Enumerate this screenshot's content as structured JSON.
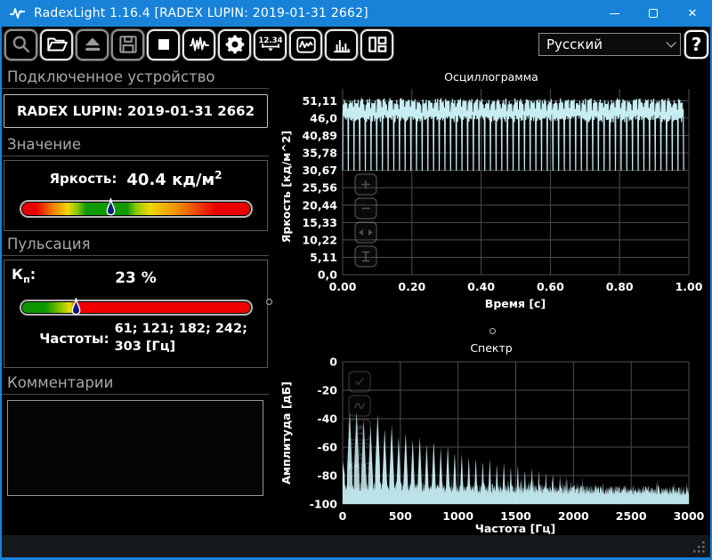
{
  "window": {
    "title": "RadexLight 1.16.4 [RADEX LUPIN: 2019-01-31 2662]"
  },
  "toolbar": {
    "buttons": [
      {
        "name": "zoom",
        "enabled": false
      },
      {
        "name": "open",
        "enabled": true
      },
      {
        "name": "eject",
        "enabled": false
      },
      {
        "name": "save",
        "enabled": false
      },
      {
        "name": "stop",
        "enabled": true
      },
      {
        "name": "oscillogram",
        "enabled": true
      },
      {
        "name": "settings",
        "enabled": true
      },
      {
        "name": "numeric-display",
        "enabled": true
      },
      {
        "name": "chart-view",
        "enabled": true
      },
      {
        "name": "spectrum",
        "enabled": true
      },
      {
        "name": "layout",
        "enabled": true
      }
    ],
    "language_select": {
      "value": "Русский"
    },
    "help_label": "?"
  },
  "device_panel": {
    "header": "Подключенное устройство",
    "device_name": "RADEX LUPIN: 2019-01-31 2662"
  },
  "value_panel": {
    "header": "Значение",
    "label": "Яркость:",
    "value": "40.4",
    "unit": "кд/м",
    "unit_exp": "2",
    "slider_percent": 39
  },
  "pulsation_panel": {
    "header": "Пульсация",
    "kp_base": "К",
    "kp_sub": "п",
    "kp_colon": ":",
    "kp_value": "23 %",
    "slider_percent": 24,
    "freq_label": "Частоты:",
    "freq_value": "61; 121; 182; 242; 303 [Гц]"
  },
  "comments_panel": {
    "header": "Комментарии",
    "text": ""
  },
  "chart_data": [
    {
      "id": "oscillogram",
      "type": "line",
      "title": "Осциллограмма",
      "xlabel": "Время [с]",
      "ylabel": "Яркость [кд/м^2]",
      "xlim": [
        0,
        1.0
      ],
      "ylim": [
        0,
        54.6
      ],
      "xtick_values": [
        0,
        0.2,
        0.4,
        0.6,
        0.8,
        1.0
      ],
      "xtick_labels": [
        "0.00",
        "0.20",
        "0.40",
        "0.60",
        "0.80",
        "1.00"
      ],
      "ytick_values": [
        51.11,
        46.0,
        40.89,
        35.78,
        30.67,
        25.56,
        20.44,
        15.33,
        10.22,
        5.11,
        0.0
      ],
      "ytick_labels": [
        "51,11",
        "46,0",
        "40,89",
        "35,78",
        "30,67",
        "25,56",
        "20,44",
        "15,33",
        "10,22",
        "5,11",
        "0,0"
      ],
      "grid": true,
      "series_color": "#c6edf2",
      "signal": {
        "kind": "periodic_lamp_flicker",
        "frequency_hz": 61,
        "min_value": 30.67,
        "max_value": 51.11,
        "mean_value": 40.4,
        "duration_s": 0.985
      }
    },
    {
      "id": "spectrum",
      "type": "area",
      "title": "Спектр",
      "xlabel": "Частота [Гц]",
      "ylabel": "Амплитуда [дБ]",
      "xlim": [
        0,
        3000
      ],
      "ylim": [
        -100,
        0
      ],
      "xtick_values": [
        0,
        500,
        1000,
        1500,
        2000,
        2500,
        3000
      ],
      "xtick_labels": [
        "0",
        "500",
        "1000",
        "1500",
        "2000",
        "2500",
        "3000"
      ],
      "ytick_values": [
        0,
        -20,
        -40,
        -60,
        -80,
        -100
      ],
      "ytick_labels": [
        "0",
        "-20",
        "-40",
        "-60",
        "-80",
        "-100"
      ],
      "grid": true,
      "series_color": "#c6edf2",
      "dc_level_db": -70,
      "noise_floor_db": -88,
      "peaks_hz_db": [
        [
          61,
          -34
        ],
        [
          121,
          -34
        ],
        [
          182,
          -40
        ],
        [
          242,
          -44
        ],
        [
          303,
          -36
        ],
        [
          364,
          -46
        ],
        [
          425,
          -44
        ],
        [
          485,
          -52
        ],
        [
          546,
          -49
        ],
        [
          607,
          -54
        ],
        [
          668,
          -52
        ],
        [
          728,
          -57
        ],
        [
          789,
          -55
        ],
        [
          850,
          -60
        ],
        [
          911,
          -58
        ],
        [
          971,
          -63
        ],
        [
          1032,
          -64
        ],
        [
          1093,
          -66
        ],
        [
          1154,
          -67
        ],
        [
          1214,
          -69
        ],
        [
          1275,
          -68
        ],
        [
          1336,
          -71
        ],
        [
          1397,
          -70
        ],
        [
          1457,
          -73
        ],
        [
          1518,
          -72
        ],
        [
          1579,
          -75
        ],
        [
          1640,
          -74
        ],
        [
          1700,
          -76
        ],
        [
          1761,
          -77
        ],
        [
          1822,
          -78
        ],
        [
          1883,
          -79
        ],
        [
          1943,
          -80
        ]
      ]
    }
  ],
  "colors": {
    "titlebar": "#1782d8",
    "accent_border": "#1782d8",
    "background": "#000000",
    "series": "#c6edf2",
    "grid": "#4e4e4e",
    "header_text": "#a8a8a8",
    "disabled_icon": "#8f8f8f"
  }
}
